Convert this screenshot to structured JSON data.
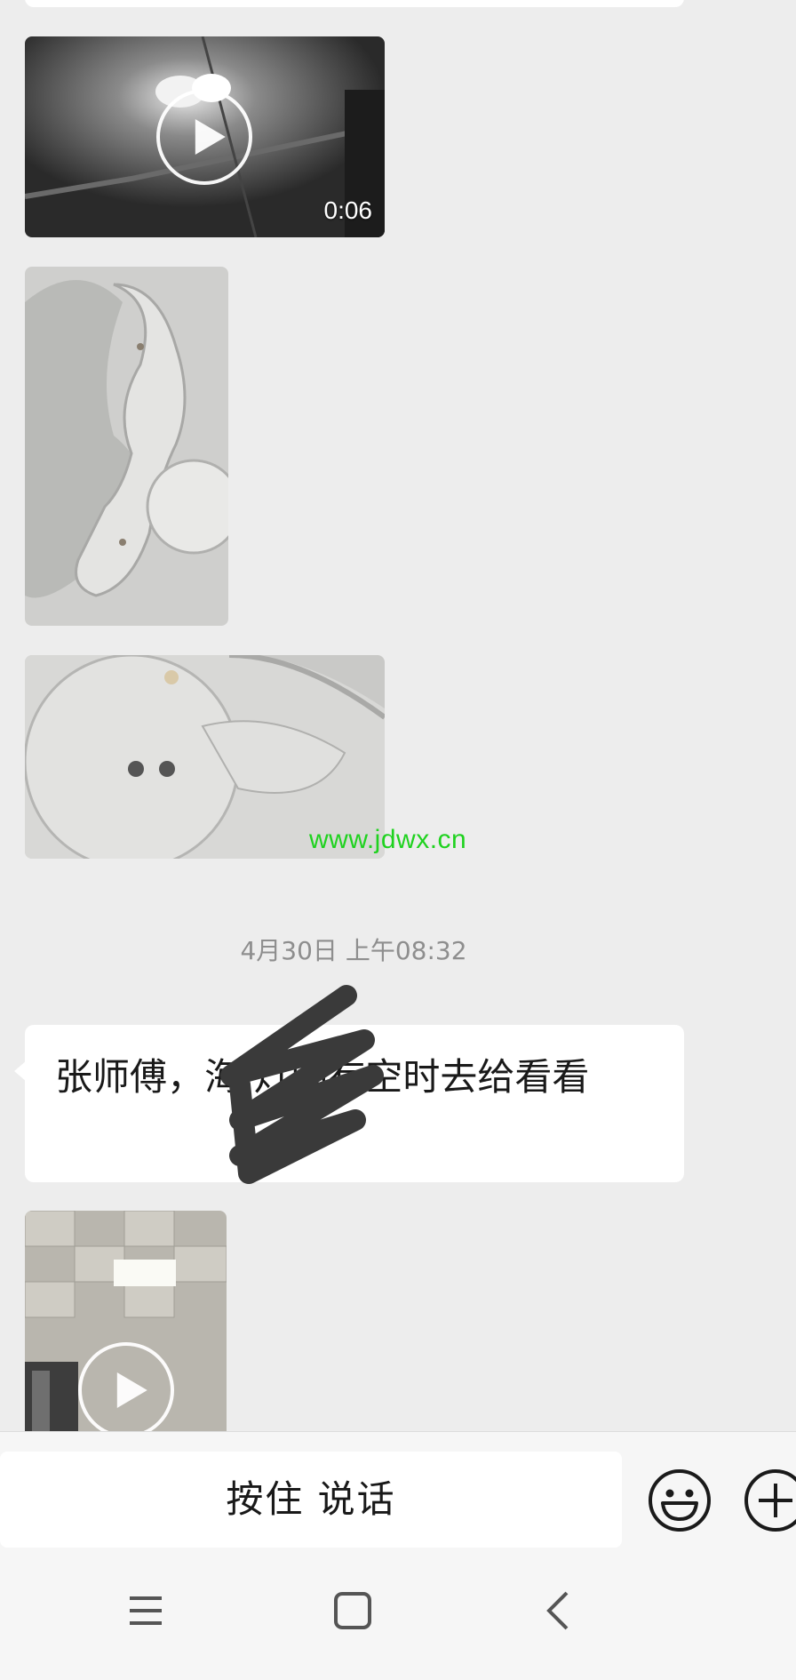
{
  "chat": {
    "video1": {
      "duration": "0:06",
      "icon": "play-icon"
    },
    "watermark": "www.jdwx.cn",
    "timestamp": "4月30日 上午08:32",
    "message": {
      "text": "张师傅，海 灯闪有空时去给看看"
    },
    "video2": {
      "icon": "play-icon"
    }
  },
  "input_bar": {
    "talk_label": "按住 说话",
    "emoji_icon": "emoji-icon",
    "plus_icon": "plus-icon"
  },
  "nav_bar": {
    "menu_icon": "menu-icon",
    "home_icon": "home-icon",
    "back_icon": "back-icon"
  },
  "colors": {
    "background": "#ededed",
    "bubble": "#ffffff",
    "watermark": "#1fd21f",
    "timestamp": "#8e8e8e"
  }
}
